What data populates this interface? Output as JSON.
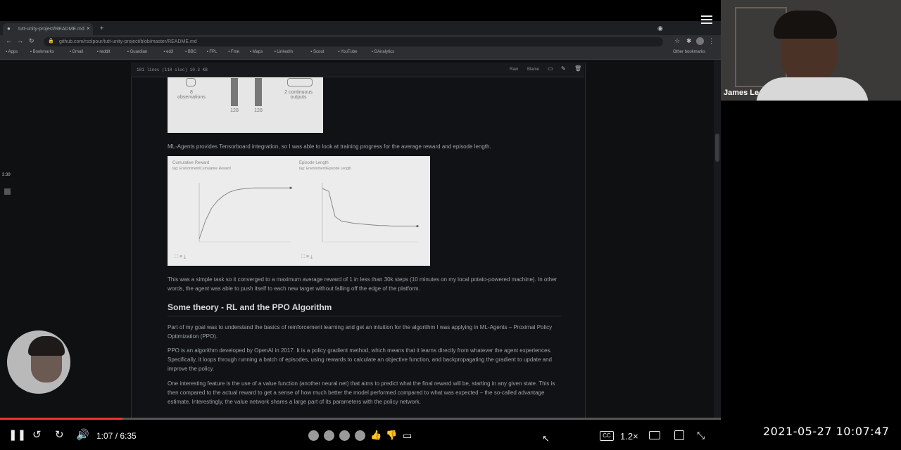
{
  "browser": {
    "tab_title": "tutt-unity-project/README.md",
    "url": "github.com/rsolpour/tutt-unity-project/blob/master/README.md",
    "bookmarks": [
      "Apps",
      "Bookmarks",
      "Gmail",
      "reddit",
      "Guardian",
      "ed3",
      "BBC",
      "FPL",
      "Fme",
      "Maps",
      "LinkedIn",
      "Scout",
      "YouTube",
      "GAnalytics"
    ],
    "other_bookmarks": "Other bookmarks"
  },
  "file": {
    "stats": "101 lines (118 sloc)   10.3 KB",
    "raw_label": "Raw",
    "blame_label": "Blame"
  },
  "diagram": {
    "left_label": "8 observations",
    "bar1": "128",
    "bar2": "128",
    "right_label": "2 continuous outputs"
  },
  "content": {
    "para1": "ML-Agents provides Tensorboard integration, so I was able to look at training progress for the average reward and episode length.",
    "para2": "This was a simple task so it converged to a maximum average reward of 1 in less than 30k steps (10 minutes on my local potato-powered machine). In other words, the agent was able to push itself to each new target without falling off the edge of the platform.",
    "heading": "Some theory - RL and the PPO Algorithm",
    "para3": "Part of my goal was to understand the basics of reinforcement learning and get an intuition for the algorithm I was applying in ML-Agents – Proximal Policy Optimization (PPO).",
    "para4": "PPO is an algorithm developed by OpenAI in 2017. It is a policy gradient method, which means that it learns directly from whatever the agent experiences. Specifically, it loops through running a batch of episodes, using rewards to calculate an objective function, and backpropagating the gradient to update and improve the policy.",
    "para5": "One interesting feature is the use of a value function (another neural net) that aims to predict what the final reward will be, starting in any given state. This is then compared to the actual reward to get a sense of how much better the model performed compared to what was expected – the so-called advantage estimate. Interestingly, the value network shares a large part of its parameters with the policy network."
  },
  "chart_data": [
    {
      "type": "line",
      "title": "Cumulative Reward",
      "subtitle": "tag: Environment/Cumulative Reward",
      "x": [
        0,
        2,
        4,
        6,
        8,
        10,
        12,
        14,
        16,
        18,
        20,
        22,
        24,
        26,
        28,
        30
      ],
      "series": [
        {
          "values": [
            0.0,
            0.35,
            0.6,
            0.75,
            0.85,
            0.92,
            0.96,
            0.98,
            0.99,
            1.0,
            1.0,
            1.0,
            1.0,
            1.0,
            1.0,
            1.0
          ]
        }
      ],
      "ylim": [
        0,
        1.1
      ],
      "color": "#888888"
    },
    {
      "type": "line",
      "title": "Episode Length",
      "subtitle": "tag: Environment/Episode Length",
      "x": [
        0,
        2,
        4,
        6,
        8,
        10,
        12,
        14,
        16,
        18,
        20,
        22,
        24,
        26,
        28,
        30
      ],
      "series": [
        {
          "values": [
            90,
            85,
            40,
            32,
            30,
            28,
            27,
            26,
            25,
            24,
            24,
            23,
            23,
            23,
            23,
            23
          ]
        }
      ],
      "ylim": [
        0,
        100
      ],
      "color": "#888888"
    }
  ],
  "player": {
    "time": "1:07 / 6:35",
    "progress": 0.17,
    "speed": "1.2×"
  },
  "webcam": {
    "name": "James Le"
  },
  "clock": "2021-05-27  10:07:47",
  "sidebar_time": "3:39"
}
